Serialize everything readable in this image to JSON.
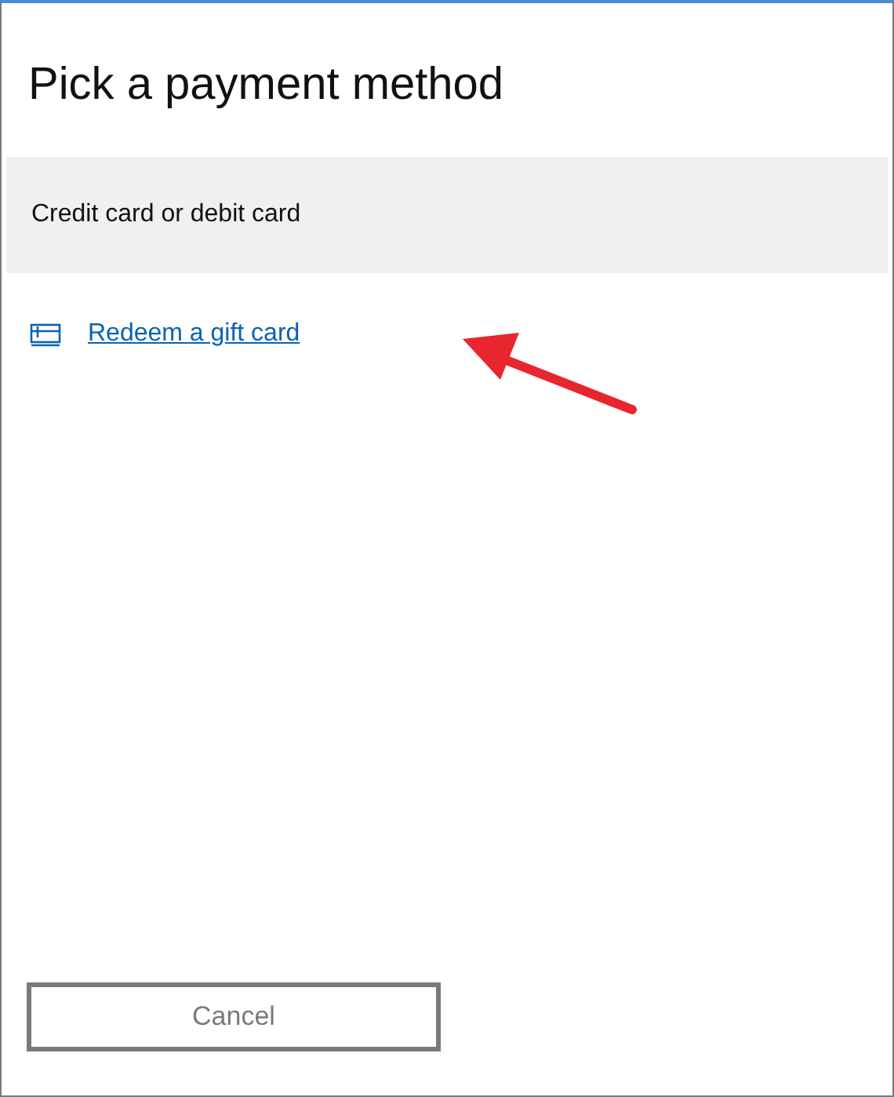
{
  "dialog": {
    "title": "Pick a payment method"
  },
  "options": [
    {
      "label": "Credit card or debit card",
      "selected": true
    }
  ],
  "link": {
    "label": "Redeem a gift card"
  },
  "buttons": [
    {
      "label": "Cancel",
      "disabled": true
    }
  ]
}
